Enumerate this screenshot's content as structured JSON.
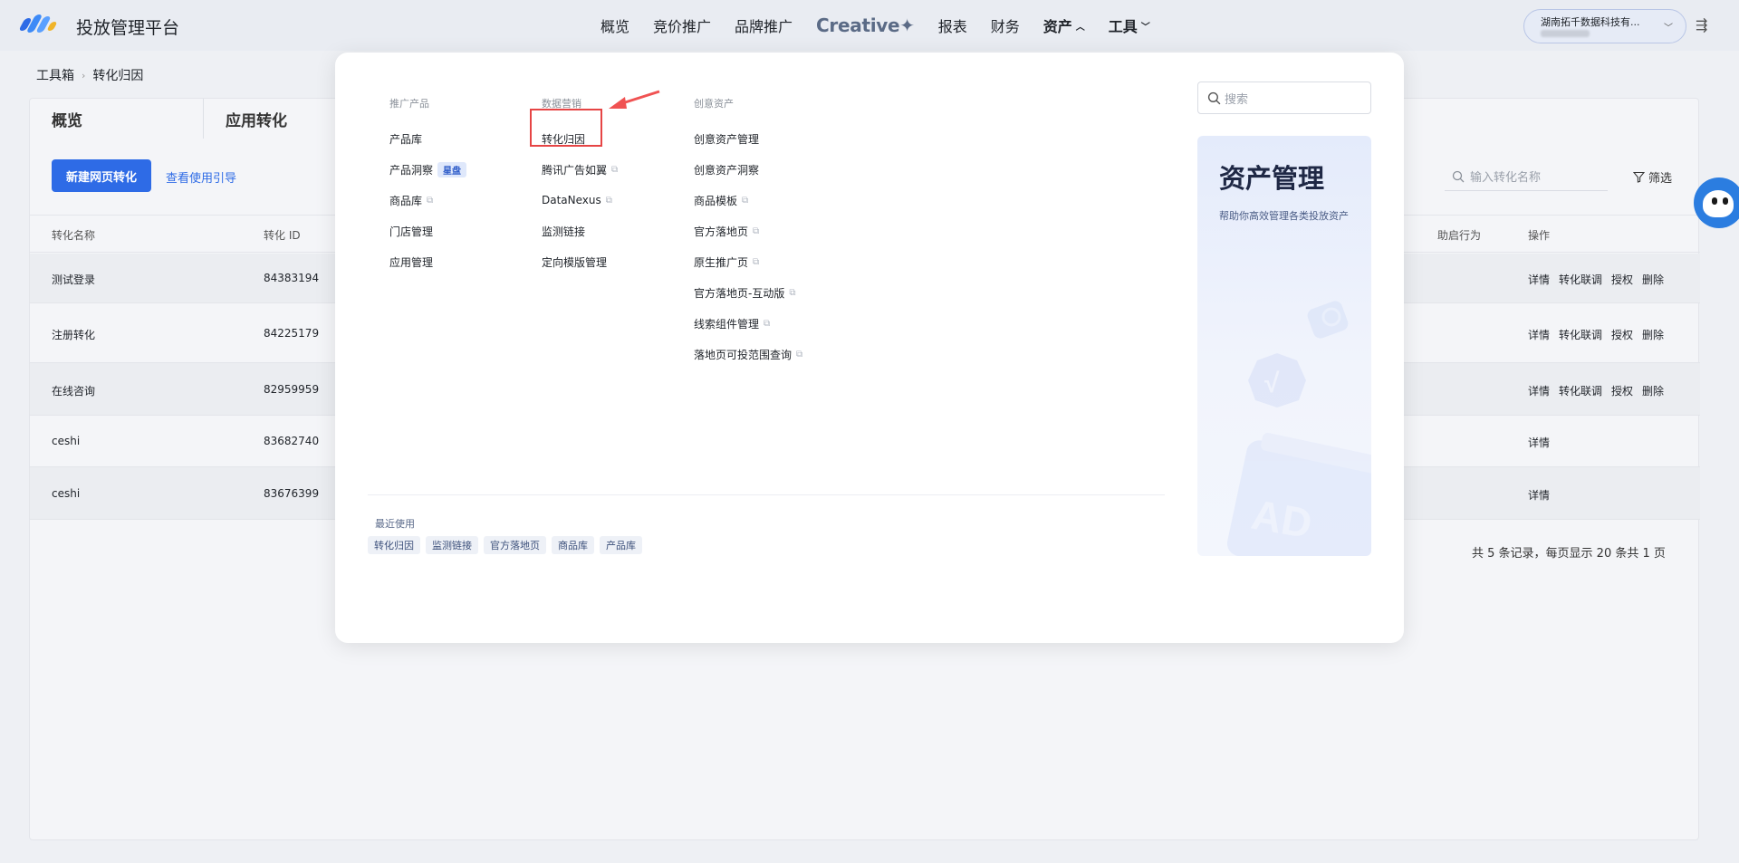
{
  "app": {
    "title": "投放管理平台"
  },
  "nav": {
    "items": [
      {
        "label": "概览"
      },
      {
        "label": "竞价推广"
      },
      {
        "label": "品牌推广"
      },
      {
        "label": "Creative✦"
      },
      {
        "label": "报表"
      },
      {
        "label": "财务"
      },
      {
        "label": "资产"
      },
      {
        "label": "工具"
      }
    ]
  },
  "account": {
    "name": "湖南拓千数据科技有..."
  },
  "breadcrumb": {
    "root": "工具箱",
    "current": "转化归因"
  },
  "page": {
    "tabs": [
      {
        "label": "概览"
      },
      {
        "label": "应用转化"
      }
    ],
    "new_button": "新建网页转化",
    "guide_link": "查看使用引导",
    "search_placeholder": "输入转化名称",
    "filter_label": "筛选",
    "columns": {
      "name": "转化名称",
      "id": "转化 ID",
      "assist": "助启行为",
      "ops": "操作"
    },
    "rows": [
      {
        "name": "测试登录",
        "id": "84383194",
        "ops": [
          "详情",
          "转化联调",
          "授权",
          "删除"
        ]
      },
      {
        "name": "注册转化",
        "id": "84225179",
        "ops": [
          "详情",
          "转化联调",
          "授权",
          "删除"
        ]
      },
      {
        "name": "在线咨询",
        "id": "82959959",
        "ops": [
          "详情",
          "转化联调",
          "授权",
          "删除"
        ]
      },
      {
        "name": "ceshi",
        "id": "83682740",
        "ops": [
          "详情"
        ]
      },
      {
        "name": "ceshi",
        "id": "83676399",
        "ops": [
          "详情"
        ]
      }
    ],
    "pager": "共 5 条记录，每页显示 20 条共 1 页"
  },
  "dropdown": {
    "columns": [
      {
        "head": "推广产品",
        "items": [
          {
            "label": "产品库"
          },
          {
            "label": "产品洞察",
            "badge": "星盘"
          },
          {
            "label": "商品库",
            "external": true
          },
          {
            "label": "门店管理"
          },
          {
            "label": "应用管理"
          }
        ]
      },
      {
        "head": "数据营销",
        "items": [
          {
            "label": "转化归因"
          },
          {
            "label": "腾讯广告如翼",
            "external": true
          },
          {
            "label": "DataNexus",
            "external": true
          },
          {
            "label": "监测链接"
          },
          {
            "label": "定向模版管理"
          }
        ]
      },
      {
        "head": "创意资产",
        "items": [
          {
            "label": "创意资产管理"
          },
          {
            "label": "创意资产洞察"
          },
          {
            "label": "商品模板",
            "external": true
          },
          {
            "label": "官方落地页",
            "external": true
          },
          {
            "label": "原生推广页",
            "external": true
          },
          {
            "label": "官方落地页-互动版",
            "external": true
          },
          {
            "label": "线索组件管理",
            "external": true
          },
          {
            "label": "落地页可投范围查询",
            "external": true
          }
        ]
      }
    ],
    "search_placeholder": "搜索",
    "recent": {
      "title": "最近使用",
      "tags": [
        "转化归因",
        "监测链接",
        "官方落地页",
        "商品库",
        "产品库"
      ]
    },
    "promo": {
      "title": "资产管理",
      "desc": "帮助你高效管理各类投放资产",
      "ad_text": "AD"
    }
  },
  "colors": {
    "primary": "#2e6be6",
    "highlight": "#e64545",
    "ext_icon": "#b0b6c0"
  }
}
